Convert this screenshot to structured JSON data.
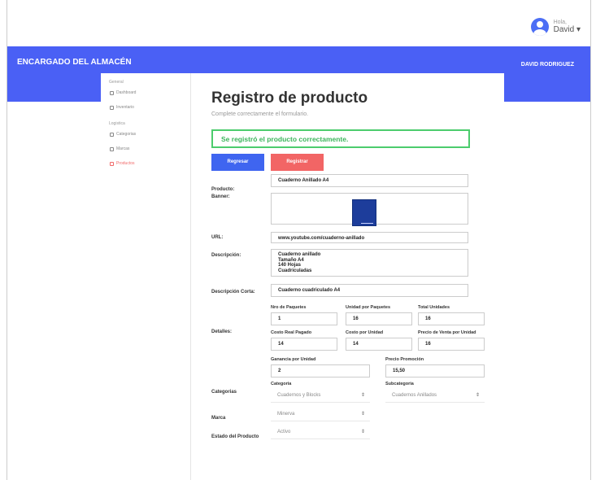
{
  "header": {
    "greeting": "Hola,",
    "user_name": "David",
    "dropdown": "▾",
    "brand": "ENCARGADO DEL ALMACÉN",
    "admin_name": "DAVID RODRIGUEZ"
  },
  "sidebar": {
    "sections": [
      {
        "title": "General",
        "items": [
          {
            "label": "Dashboard",
            "icon": "dashboard-icon"
          },
          {
            "label": "Inventario",
            "icon": "inventory-icon"
          }
        ]
      },
      {
        "title": "Logistica",
        "items": [
          {
            "label": "Categorias",
            "icon": "category-icon"
          },
          {
            "label": "Marcas",
            "icon": "tag-icon"
          },
          {
            "label": "Productos",
            "icon": "product-icon",
            "active": true
          }
        ]
      }
    ]
  },
  "page": {
    "title": "Registro de producto",
    "subtitle": "Complete correctamente el formulario.",
    "alert": "Se registró el producto correctamente."
  },
  "buttons": {
    "back": "Regresar",
    "save": "Registrar"
  },
  "form": {
    "product_label": "Producto:",
    "product_value": "Cuaderno  Anillado A4",
    "banner_label": "Banner:",
    "url_label": "URL:",
    "url_value": "www.youtube.com/cuaderno-anillado",
    "description_label": "Descripción:",
    "description_value": "Cuaderno anillado\nTamaño A4\n140 Hojas\nCuadriculadas",
    "short_desc_label": "Descripción Corta:",
    "short_desc_value": "Cuaderno cuadriculado A4",
    "details_label": "Detalles:",
    "packages_label": "Nro de Paquetes",
    "packages_value": "1",
    "units_per_package_label": "Unidad por Paquetes",
    "units_per_package_value": "16",
    "total_units_label": "Total Unidades",
    "total_units_value": "16",
    "real_cost_label": "Costo Real Pagado",
    "real_cost_value": "14",
    "cost_per_unit_label": "Costo por Unidad",
    "cost_per_unit_value": "14",
    "sale_price_label": "Precio de Venta por Unidad",
    "sale_price_value": "16",
    "profit_label": "Ganancia por Unidad",
    "profit_value": "2",
    "promo_price_label": "Precio Promoción",
    "promo_price_value": "15,50",
    "categories_label": "Categorias",
    "category_label": "Categoria",
    "category_value": "Cuadernos y Blocks",
    "subcategory_label": "Subcategoria",
    "subcategory_value": "Cuadernos Anillados",
    "brand_label": "Marca",
    "brand_value": "Minerva",
    "status_label": "Estado del Producto",
    "status_value": "Activo",
    "select_arrow": "⇕"
  }
}
